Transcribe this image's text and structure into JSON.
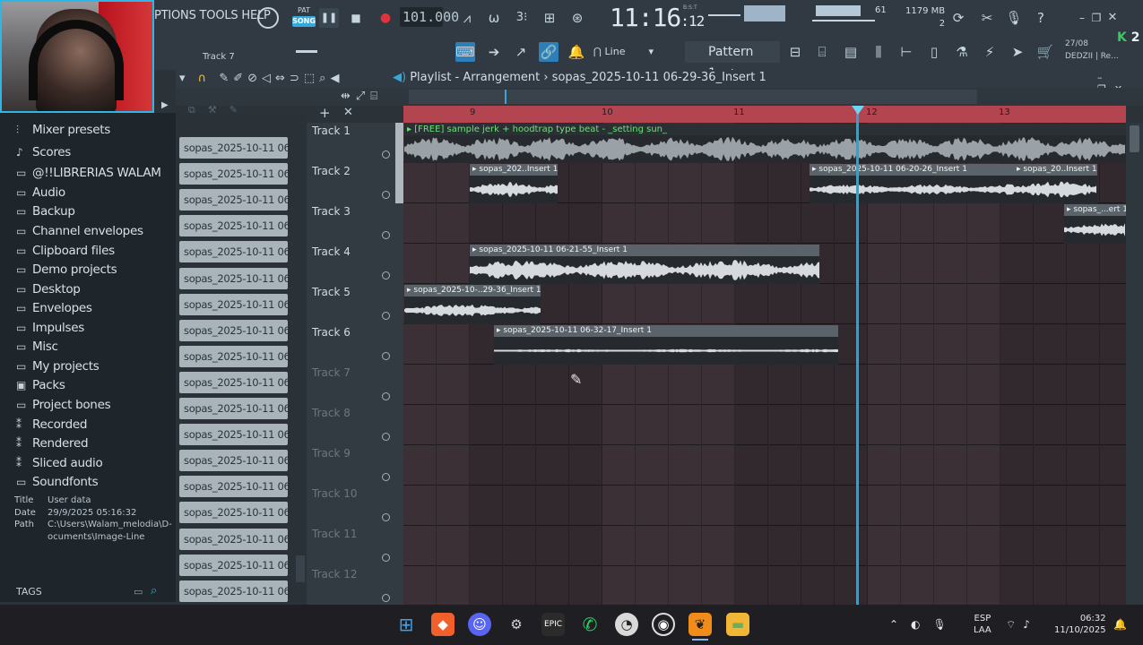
{
  "menu": {
    "text": "PTIONS TOOLS HELP"
  },
  "transport": {
    "pat": "PAT",
    "song": "SONG",
    "tempo": "101.000",
    "time_main": "11:16",
    "time_sec": "12",
    "time_sub": "B:S:T"
  },
  "resources": {
    "cpu": "61",
    "mem": "1179 MB",
    "voices": "2"
  },
  "toolbar": {
    "snap": "Line",
    "pattern": "Pattern 1",
    "date": "27/08",
    "user": "DEDZII | Re...",
    "track_label": "Track 7",
    "badge": "2"
  },
  "playlist": {
    "title": "Playlist - Arrangement",
    "sep": "›",
    "clipname": "sopas_2025-10-11 06-29-36_Insert 1"
  },
  "ruler": {
    "bars": [
      "9",
      "10",
      "11",
      "12",
      "13"
    ]
  },
  "browser": {
    "items": [
      "Mixer presets",
      "Scores",
      "@!!LIBRERIAS WALAM",
      "Audio",
      "Backup",
      "Channel envelopes",
      "Clipboard files",
      "Demo projects",
      "Desktop",
      "Envelopes",
      "Impulses",
      "Misc",
      "My projects",
      "Packs",
      "Project bones",
      "Recorded",
      "Rendered",
      "Sliced audio",
      "Soundfonts"
    ],
    "info": {
      "title_k": "Title",
      "title_v": "User data",
      "date_k": "Date",
      "date_v": "29/9/2025 05:16:32",
      "path_k": "Path",
      "path_v1": "C:\\Users\\Walam_melodia\\D-",
      "path_v2": "ocuments\\Image-Line"
    },
    "tags": "TAGS"
  },
  "cliplist": [
    "sopas_2025-10-11 06-2...",
    "sopas_2025-10-11 06-2...",
    "sopas_2025-10-11 06-2...",
    "sopas_2025-10-11 06-2...",
    "sopas_2025-10-11 06-2...",
    "sopas_2025-10-11 06-2...",
    "sopas_2025-10-11 06-2...",
    "sopas_2025-10-11 06-2...",
    "sopas_2025-10-11 06-2...",
    "sopas_2025-10-11 06-2...",
    "sopas_2025-10-11 06-2...",
    "sopas_2025-10-11 06-2...",
    "sopas_2025-10-11 06-3...",
    "sopas_2025-10-11 06-3...",
    "sopas_2025-10-11 06-3...",
    "sopas_2025-10-11 06-3...",
    "sopas_2025-10-11 06-3...",
    "sopas_2025-10-11 06-3...",
    "sopas_2025-10-11 06-3..."
  ],
  "tracks": [
    "Track 1",
    "Track 2",
    "Track 3",
    "Track 4",
    "Track 5",
    "Track 6",
    "Track 7",
    "Track 8",
    "Track 9",
    "Track 10",
    "Track 11",
    "Track 12"
  ],
  "clips": {
    "t1": "[FREE] sample jerk + hoodtrap type beat - _setting sun_",
    "t2a": "sopas_202..Insert 1",
    "t2b": "sopas_2025-10-11 06-20-26_Insert 1",
    "t2c": "sopas_20..Insert 1",
    "t3": "sopas_...ert 1",
    "t4": "sopas_2025-10-11 06-21-55_Insert 1",
    "t5": "sopas_2025-10-..29-36_Insert 1",
    "t6": "sopas_2025-10-11 06-32-17_Insert 1"
  },
  "taskbar": {
    "lang1": "ESP",
    "lang2": "LAA",
    "time": "06:32",
    "date": "11/10/2025"
  }
}
